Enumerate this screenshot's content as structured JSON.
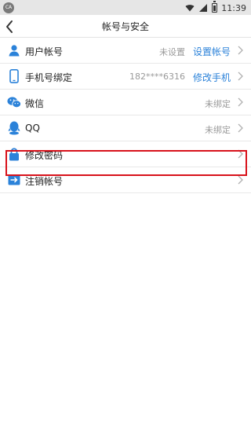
{
  "status_bar": {
    "left_icon_text": "CA",
    "time": "11:39"
  },
  "header": {
    "title": "帐号与安全"
  },
  "rows": [
    {
      "icon": "user-icon",
      "label": "用户帐号",
      "value": "未设置",
      "action": "设置帐号"
    },
    {
      "icon": "phone-icon",
      "label": "手机号绑定",
      "value": "182****6316",
      "action": "修改手机"
    },
    {
      "icon": "wechat-icon",
      "label": "微信",
      "value": "未绑定"
    },
    {
      "icon": "qq-icon",
      "label": "QQ",
      "value": "未绑定"
    },
    {
      "icon": "lock-icon",
      "label": "修改密码"
    },
    {
      "icon": "logout-icon",
      "label": "注销帐号"
    }
  ],
  "colors": {
    "accent": "#2b82d9",
    "highlight": "#d8121b"
  }
}
